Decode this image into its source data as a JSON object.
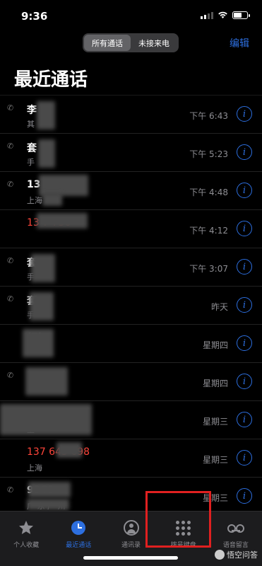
{
  "status_bar": {
    "time": "9:36",
    "battery_level": 0.7
  },
  "header": {
    "segments": [
      {
        "label": "所有通话"
      },
      {
        "label": "未接来电"
      }
    ],
    "edit_label": "编辑",
    "title": "最近通话"
  },
  "calls": [
    {
      "name": "李",
      "sub": "其",
      "time": "下午 6:43",
      "missed": false
    },
    {
      "name": "套",
      "sub": "手",
      "time": "下午 5:23",
      "missed": false
    },
    {
      "name": "13    7    756",
      "sub": "上海",
      "time": "下午 4:48",
      "missed": false
    },
    {
      "name": "13       7    756",
      "sub": "",
      "time": "下午 4:12",
      "missed": true
    },
    {
      "name": "套",
      "sub": "手",
      "time": "下午 3:07",
      "missed": false
    },
    {
      "name": "套",
      "sub": "手",
      "time": "昨天",
      "missed": false
    },
    {
      "name": "(3)",
      "sub": "",
      "time": "星期四",
      "missed": false
    },
    {
      "name": "",
      "sub": "",
      "time": "星期四",
      "missed": false
    },
    {
      "name": "98",
      "sub": "上",
      "time": "星期三",
      "missed": false
    },
    {
      "name": "137 645     698",
      "sub": "上海",
      "time": "星期三",
      "missed": true
    },
    {
      "name": "9369",
      "sub": "广 东 广 州",
      "time": "星期三",
      "missed": false
    }
  ],
  "tab_bar": {
    "tabs": [
      {
        "label": "个人收藏",
        "icon": "star-icon"
      },
      {
        "label": "最近通话",
        "icon": "clock-icon"
      },
      {
        "label": "通讯录",
        "icon": "person-circle-icon"
      },
      {
        "label": "拨号键盘",
        "icon": "keypad-icon"
      },
      {
        "label": "语音留言",
        "icon": "voicemail-icon"
      }
    ]
  },
  "watermark": {
    "text": "悟空问答"
  },
  "colors": {
    "accent": "#2d6fe0",
    "missed": "#ff453a",
    "highlight": "#e02020"
  }
}
